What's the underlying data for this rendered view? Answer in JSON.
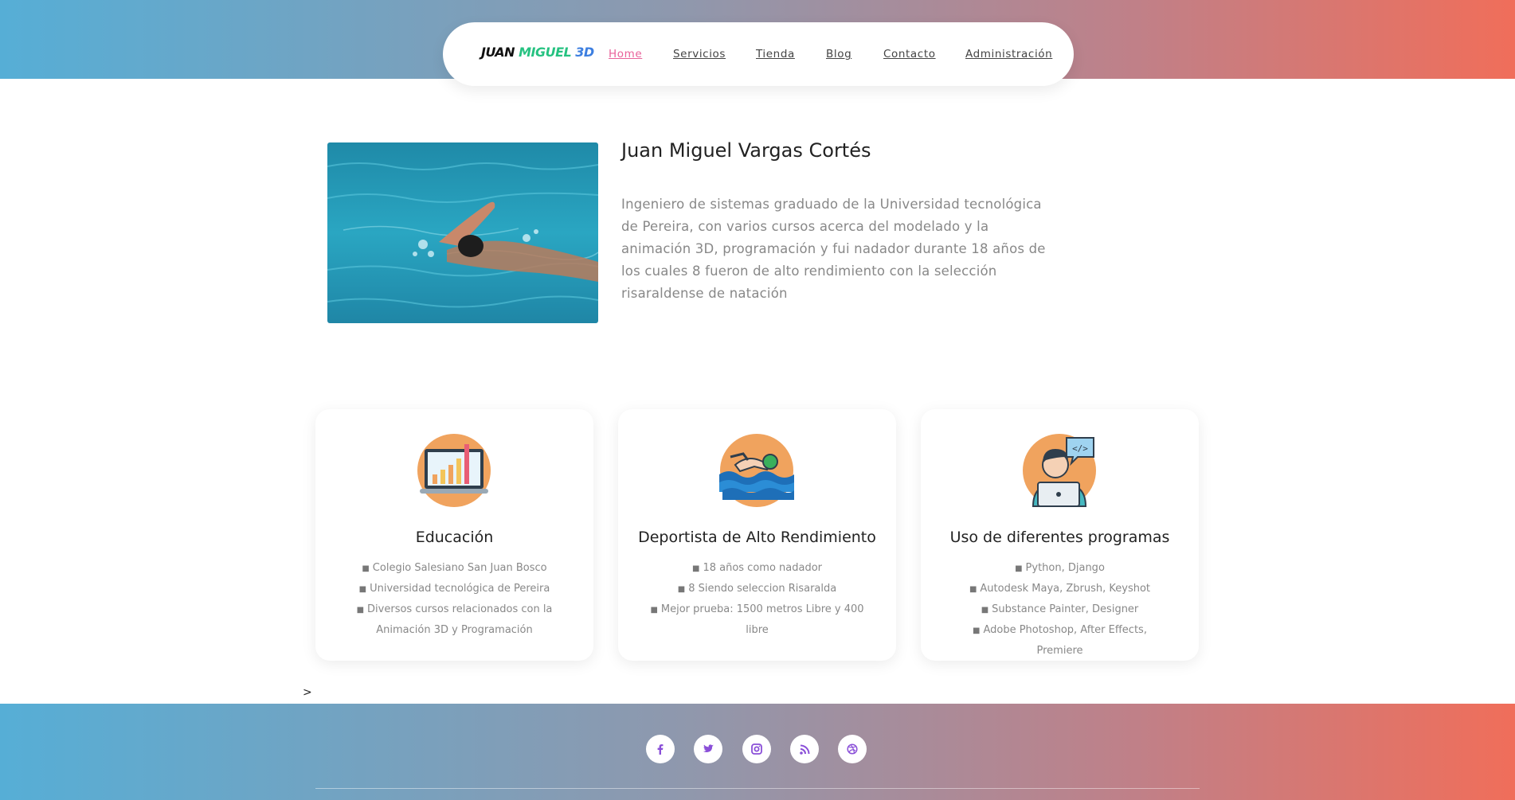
{
  "nav": {
    "logo": {
      "part1": "JUAN",
      "part2": "MIGUEL",
      "part3": "3D"
    },
    "links": [
      "Home",
      "Servicios",
      "Tienda",
      "Blog",
      "Contacto",
      "Administración"
    ],
    "active_link": "Home",
    "accent_color": "#e9629a"
  },
  "hero": {
    "name": "Juan Miguel Vargas Cortés",
    "description": "Ingeniero de sistemas graduado de la Universidad tecnológica de Pereira, con varios cursos acerca del modelado y la animación 3D, programación y fui nadador durante 18 años de los cuales 8 fueron de alto rendimiento con la selección risaraldense de natación",
    "image_icon": "swimmer-photo"
  },
  "cards": [
    {
      "icon": "laptop-chart-icon",
      "title": "Educación",
      "items": [
        "Colegio Salesiano San Juan Bosco",
        "Universidad tecnológica de Pereira",
        "Diversos cursos relacionados con la Animación 3D y Programación"
      ]
    },
    {
      "icon": "swimmer-icon",
      "title": "Deportista de Alto Rendimiento",
      "items": [
        "18 años como nadador",
        "8 Siendo seleccion Risaralda",
        "Mejor prueba: 1500 metros Libre y 400 libre"
      ]
    },
    {
      "icon": "developer-laptop-icon",
      "title": "Uso de diferentes programas",
      "items": [
        "Python, Django",
        "Autodesk Maya, Zbrush, Keyshot",
        "Substance Painter, Designer",
        "Adobe Photoshop, After Effects, Premiere"
      ]
    }
  ],
  "bullet": "■",
  "stray_text": ">",
  "footer": {
    "social_icons": [
      "facebook-icon",
      "twitter-icon",
      "instagram-icon",
      "rss-icon",
      "dribbble-icon"
    ],
    "icon_color": "#8a4fd8"
  },
  "colors": {
    "gradient_start": "#56aed6",
    "gradient_end": "#f06e5a",
    "icon_circle": "#f0a35e"
  }
}
